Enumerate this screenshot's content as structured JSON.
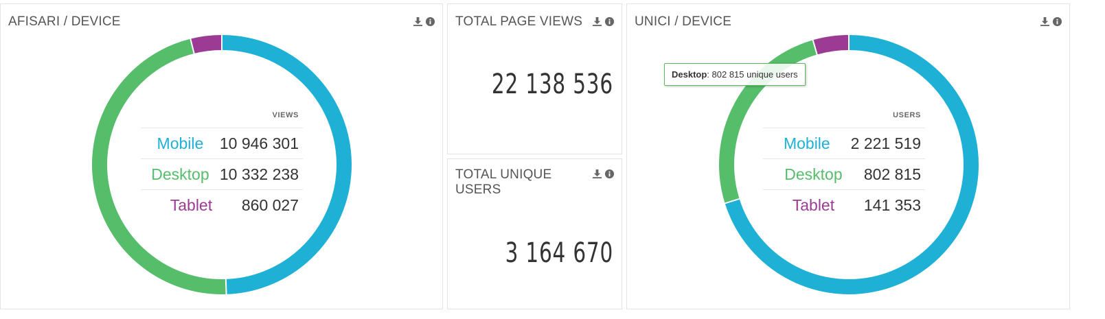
{
  "panels": {
    "views_by_device": {
      "title": "AFISARI / DEVICE",
      "legend_header": "VIEWS",
      "rows": [
        {
          "label": "Mobile",
          "value": "10 946 301"
        },
        {
          "label": "Desktop",
          "value": "10 332 238"
        },
        {
          "label": "Tablet",
          "value": "860 027"
        }
      ]
    },
    "total_page_views": {
      "title": "TOTAL PAGE VIEWS",
      "value": "22 138 536"
    },
    "total_unique_users": {
      "title": "TOTAL UNIQUE\nUSERS",
      "value": "3 164 670"
    },
    "uniques_by_device": {
      "title": "UNICI / DEVICE",
      "legend_header": "USERS",
      "rows": [
        {
          "label": "Mobile",
          "value": "2 221 519"
        },
        {
          "label": "Desktop",
          "value": "802 815"
        },
        {
          "label": "Tablet",
          "value": "141 353"
        }
      ],
      "tooltip": {
        "series": "Desktop",
        "text": ": 802 815 unique users"
      }
    }
  },
  "icons": {
    "download": "download-icon",
    "info": "info-icon"
  },
  "colors": {
    "mobile": "#1fb0d6",
    "desktop": "#56bd6b",
    "tablet": "#9b3b94",
    "tooltip_border": "#5cb85c"
  },
  "chart_data": [
    {
      "type": "pie",
      "categories": [
        "Mobile",
        "Desktop",
        "Tablet"
      ],
      "values": [
        10946301,
        10332238,
        860027
      ],
      "legend": "center"
    },
    {
      "type": "pie",
      "categories": [
        "Mobile",
        "Desktop",
        "Tablet"
      ],
      "values": [
        2221519,
        802815,
        141353
      ],
      "legend": "center"
    }
  ]
}
